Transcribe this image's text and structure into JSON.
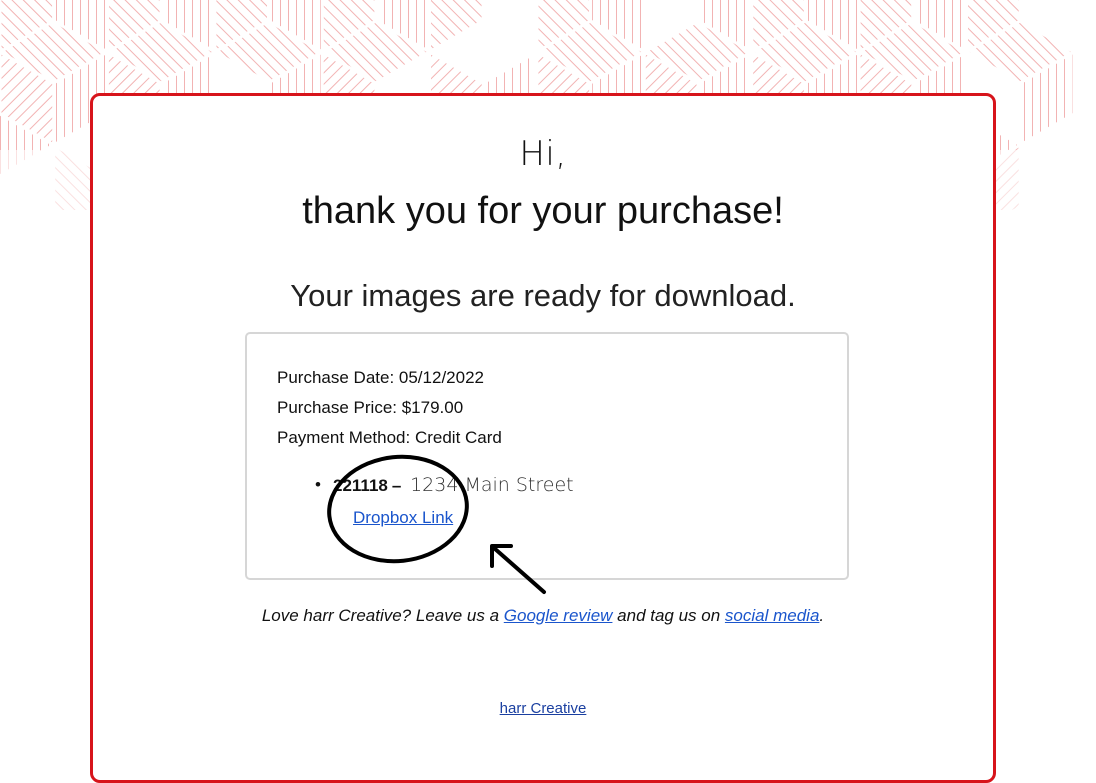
{
  "colors": {
    "frame": "#d7141b",
    "link": "#1a55cc",
    "box_border": "#d6d6d6",
    "pattern": "#f2b3b3"
  },
  "email": {
    "greeting": "Hi,",
    "thanks": "thank you for your purchase!",
    "ready": "Your images are ready for download."
  },
  "purchase": {
    "date_line": "Purchase Date: 05/12/2022",
    "price_line": "Purchase Price: $179.00",
    "method_line": "Payment Method: Credit Card",
    "item": {
      "bullet": "•",
      "code": "221118",
      "dash": "–",
      "address": "1234 Main Street",
      "link_label": "Dropbox Link"
    }
  },
  "review": {
    "prefix": "Love harr Creative? Leave us a ",
    "google_link": "Google review",
    "middle": " and tag us on ",
    "social_link": "social media",
    "suffix": "."
  },
  "footer": {
    "link": "harr Creative"
  },
  "annotation": {
    "icons": [
      "circle-highlight-icon",
      "arrow-pointer-icon"
    ]
  }
}
